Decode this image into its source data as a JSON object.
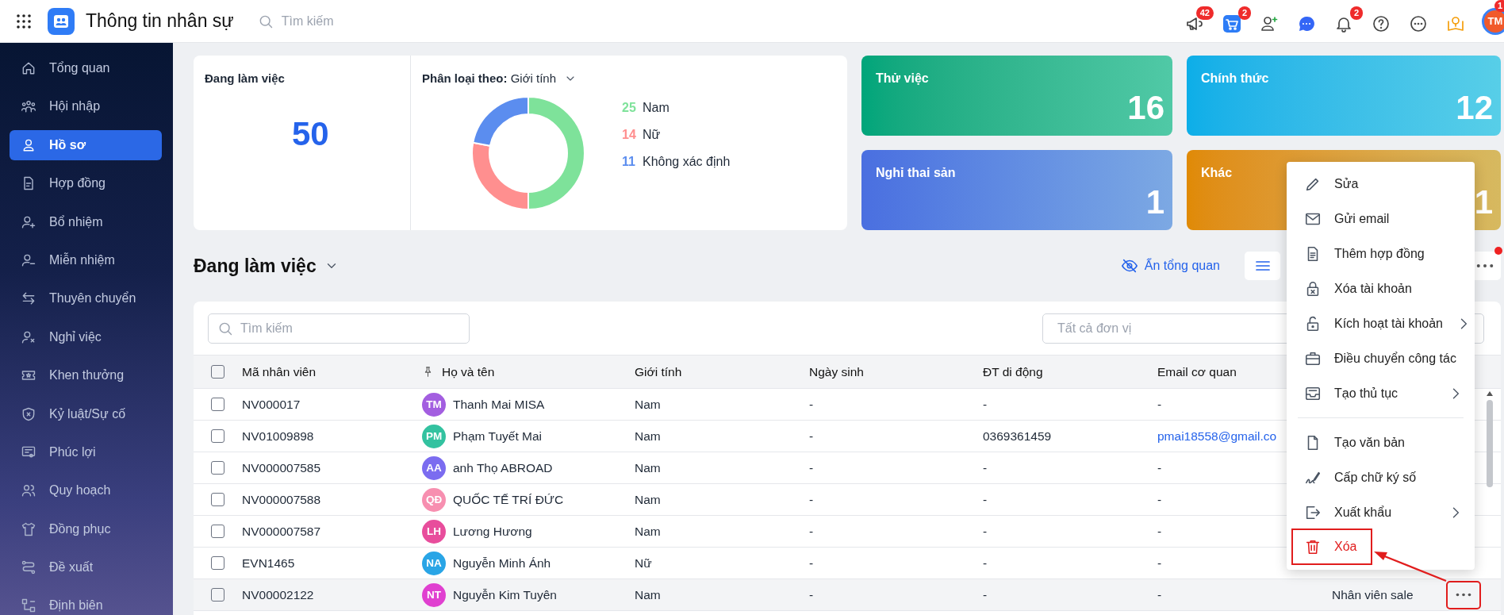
{
  "app": {
    "title": "Thông tin nhân sự",
    "search_placeholder": "Tìm kiếm"
  },
  "toolbar": [
    {
      "kind": "megaphone",
      "badge": "42"
    },
    {
      "kind": "cart",
      "badge": "2"
    },
    {
      "kind": "adduser"
    },
    {
      "kind": "chat"
    },
    {
      "kind": "bell",
      "badge": "2"
    },
    {
      "kind": "help"
    },
    {
      "kind": "more"
    },
    {
      "kind": "idea"
    }
  ],
  "account": {
    "initials": "TM",
    "badge": "1"
  },
  "sidebar": {
    "items": [
      {
        "label": "Tổng quan",
        "selected": false
      },
      {
        "label": "Hội nhập",
        "selected": false
      },
      {
        "label": "Hồ sơ",
        "selected": true
      },
      {
        "label": "Hợp đồng",
        "selected": false
      },
      {
        "label": "Bổ nhiệm",
        "selected": false
      },
      {
        "label": "Miễn nhiệm",
        "selected": false
      },
      {
        "label": "Thuyên chuyển",
        "selected": false
      },
      {
        "label": "Nghỉ việc",
        "selected": false
      },
      {
        "label": "Khen thưởng",
        "selected": false
      },
      {
        "label": "Kỷ luật/Sự cố",
        "selected": false
      },
      {
        "label": "Phúc lợi",
        "selected": false
      },
      {
        "label": "Quy hoạch",
        "selected": false
      },
      {
        "label": "Đồng phục",
        "selected": false
      },
      {
        "label": "Đề xuất",
        "selected": false
      },
      {
        "label": "Định biên",
        "selected": false
      }
    ]
  },
  "overview": {
    "title": "Đang làm việc",
    "total": "50",
    "classify": "**Phân loại theo:** Giới tính",
    "legend": [
      {
        "count": "25",
        "label": "Nam",
        "color": "#7ee29a"
      },
      {
        "count": "14",
        "label": "Nữ",
        "color": "#ff8f8f"
      },
      {
        "count": "11",
        "label": "Không xác định",
        "color": "#5b8def"
      }
    ],
    "chart_data": {
      "type": "donut",
      "values": [
        50,
        28,
        22
      ]
    }
  },
  "status_cards": [
    {
      "title": "Thử việc",
      "count": "16",
      "color": "#00a57a"
    },
    {
      "title": "Chính thức",
      "count": "12",
      "color": "#0caee8"
    },
    {
      "title": "Nghỉ thai sản",
      "count": "1",
      "color": "#4a6fe0"
    },
    {
      "title": "Khác",
      "count": "1",
      "color": "#e08a05"
    }
  ],
  "list": {
    "title": "Đang làm việc",
    "hide_overview": "Ẩn tổng quan",
    "notice_dot": true
  },
  "table": {
    "search_placeholder": "Tìm kiếm",
    "unit_placeholder": "Tất cả đơn vị",
    "all_checked": false,
    "columns": [
      "Mã nhân viên",
      "Họ và tên",
      "Giới tính",
      "Ngày sinh",
      "ĐT di động",
      "Email cơ quan"
    ],
    "rows": [
      {
        "code": "NV000017",
        "initials": "TM",
        "color": "#a35ee0",
        "name": "Thanh Mai MISA",
        "gender": "Nam",
        "dob": "-",
        "phone": "-",
        "email": "-",
        "email_link": false,
        "checked": false,
        "hovered": false
      },
      {
        "code": "NV01009898",
        "initials": "PM",
        "color": "#33c2a0",
        "name": "Phạm Tuyết Mai",
        "gender": "Nam",
        "dob": "-",
        "phone": "0369361459",
        "email": "pmai18558@gmail.co",
        "email_link": true,
        "checked": false,
        "hovered": false
      },
      {
        "code": "NV000007585",
        "initials": "AA",
        "color": "#7b6cf0",
        "name": "anh Thọ ABROAD",
        "gender": "Nam",
        "dob": "-",
        "phone": "-",
        "email": "-",
        "email_link": false,
        "checked": false,
        "hovered": false
      },
      {
        "code": "NV000007588",
        "initials": "QĐ",
        "color": "#f78fb0",
        "name": "QUỐC TẾ TRÍ ĐỨC",
        "gender": "Nam",
        "dob": "-",
        "phone": "-",
        "email": "-",
        "email_link": false,
        "checked": false,
        "hovered": false
      },
      {
        "code": "NV000007587",
        "initials": "LH",
        "color": "#e84d9c",
        "name": "Lương Hương",
        "gender": "Nam",
        "dob": "-",
        "phone": "-",
        "email": "-",
        "email_link": false,
        "checked": false,
        "hovered": false
      },
      {
        "code": "EVN1465",
        "initials": "NA",
        "color": "#29a5e6",
        "name": "Nguyễn Minh Ánh",
        "gender": "Nữ",
        "dob": "-",
        "phone": "-",
        "email": "-",
        "email_link": false,
        "checked": false,
        "hovered": false
      },
      {
        "code": "NV00002122",
        "initials": "NT",
        "color": "#e040d0",
        "name": "Nguyễn Kim Tuyên",
        "gender": "Nam",
        "dob": "-",
        "phone": "-",
        "email": "-",
        "email_link": false,
        "position": "Nhân viên sale",
        "checked": false,
        "hovered": true,
        "annotated": true
      }
    ]
  },
  "context_menu": {
    "items": [
      {
        "label": "Sửa",
        "kind": "action"
      },
      {
        "label": "Gửi email",
        "kind": "action"
      },
      {
        "label": "Thêm hợp đồng",
        "kind": "action"
      },
      {
        "label": "Xóa tài khoản",
        "kind": "action"
      },
      {
        "label": "Kích hoạt tài khoản",
        "kind": "action",
        "submenu": true
      },
      {
        "label": "Điều chuyển công tác",
        "kind": "action"
      },
      {
        "label": "Tạo thủ tục",
        "kind": "action",
        "submenu": true
      },
      {
        "label": "Tạo văn bản",
        "kind": "action",
        "divider_before": true
      },
      {
        "label": "Cấp chữ ký số",
        "kind": "action"
      },
      {
        "label": "Xuất khẩu",
        "kind": "action",
        "submenu": true
      },
      {
        "label": "Xóa",
        "kind": "danger",
        "annotated": true
      }
    ]
  },
  "callout_arrow": true
}
